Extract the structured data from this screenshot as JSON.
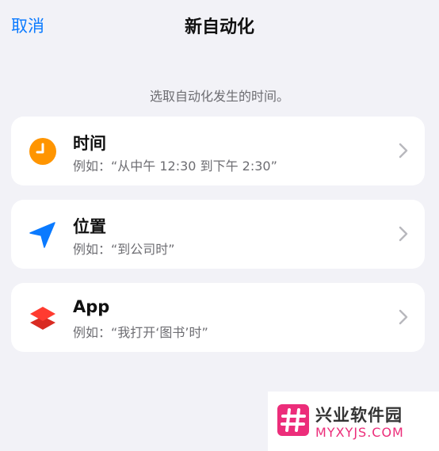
{
  "nav": {
    "cancel_label": "取消",
    "title": "新自动化"
  },
  "hint": "选取自动化发生的时间。",
  "options": [
    {
      "title": "时间",
      "subtitle": "例如：“从中午 12:30 到下午 2:30”",
      "icon": "clock-icon",
      "icon_color": "#ff9500"
    },
    {
      "title": "位置",
      "subtitle": "例如：“到公司时”",
      "icon": "location-arrow-icon",
      "icon_color": "#0a7aff"
    },
    {
      "title": "App",
      "subtitle": "例如：“我打开‘图书’时”",
      "icon": "app-layers-icon",
      "icon_color": "#ff3b30"
    }
  ],
  "watermark": {
    "name": "兴业软件园",
    "url": "MYXYJS.COM",
    "accent": "#ec2d7a"
  }
}
